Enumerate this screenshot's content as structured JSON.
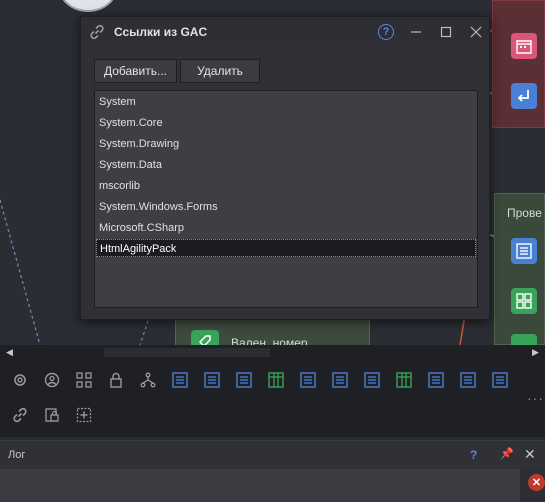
{
  "dialog": {
    "title": "Ссылки из GAC",
    "add_label": "Добавить...",
    "remove_label": "Удалить",
    "assemblies": [
      "System",
      "System.Core",
      "System.Drawing",
      "System.Data",
      "mscorlib",
      "System.Windows.Forms",
      "Microsoft.CSharp",
      "HtmlAgilityPack"
    ],
    "selected_index": 7
  },
  "background": {
    "green_node_label": "Прове",
    "bottom_node_label": "Вален. номер"
  },
  "log": {
    "title": "Лог",
    "help": "?"
  },
  "colors": {
    "accent_blue": "#5a86e0",
    "tile_blue": "#4a7fd6",
    "tile_green": "#3aa35a",
    "tile_pink": "#d9557a",
    "error_red": "#c0392b"
  },
  "icons": {
    "toolbar_row1": [
      "gear-icon",
      "user-icon",
      "grid-icon",
      "lock-icon",
      "branch-icon",
      "list-icon",
      "list-icon",
      "list-icon",
      "table-icon",
      "list-icon",
      "list-icon",
      "list-icon",
      "table-icon",
      "list-icon",
      "list-icon",
      "list-icon"
    ],
    "toolbar_row2": [
      "link-icon",
      "db-lock-icon",
      "add-box-icon"
    ]
  }
}
